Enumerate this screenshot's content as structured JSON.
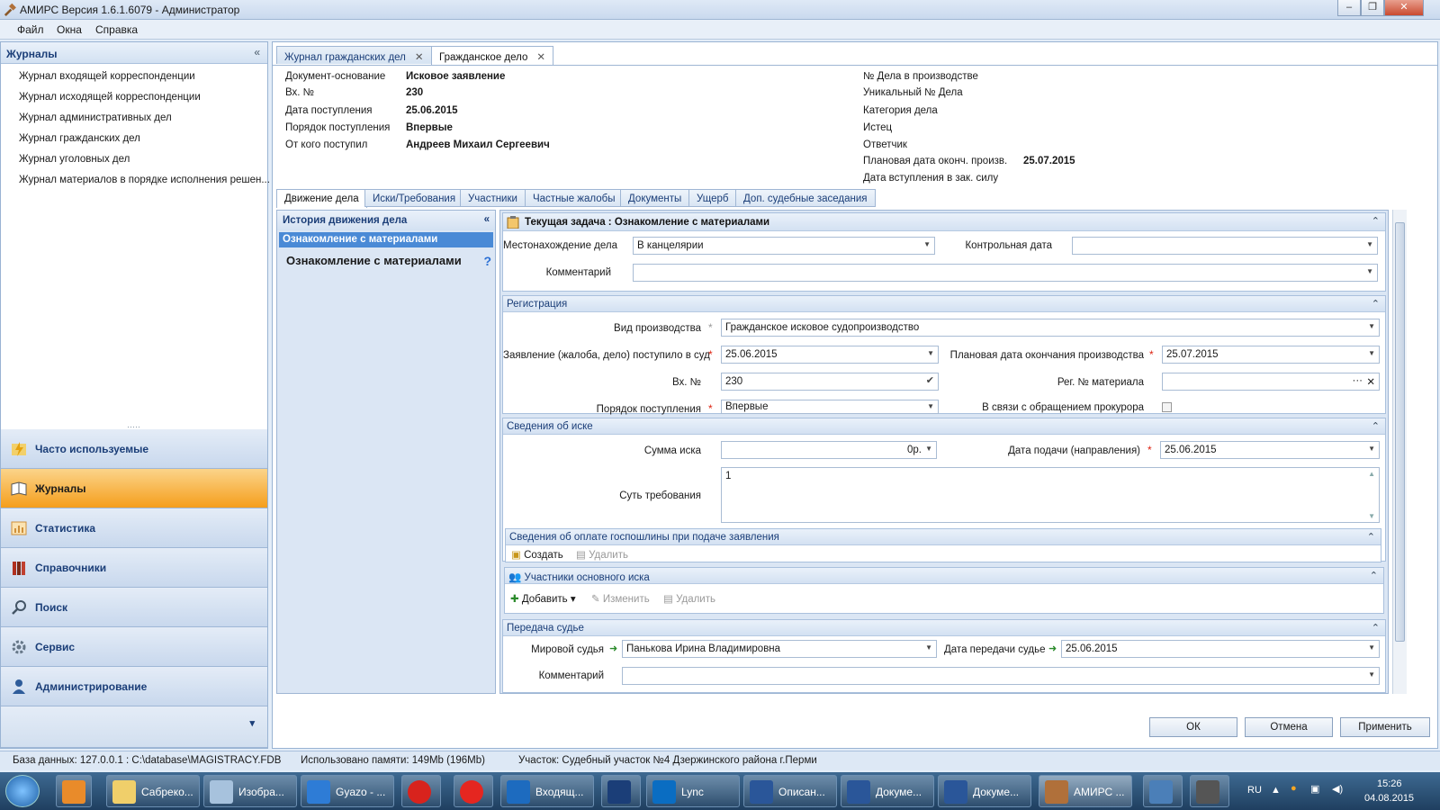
{
  "window": {
    "title": "АМИРС Версия 1.6.1.6079 - Администратор",
    "min": "‒",
    "restore": "❐",
    "close": "✕"
  },
  "menu": [
    "Файл",
    "Окна",
    "Справка"
  ],
  "left": {
    "header": "Журналы",
    "collapse": "«",
    "journals": [
      "Журнал входящей корреспонденции",
      "Журнал исходящей корреспонденции",
      "Журнал административных дел",
      "Журнал гражданских дел",
      "Журнал уголовных дел",
      "Журнал материалов в порядке исполнения решен..."
    ],
    "splitter": "·····",
    "nav": [
      "Часто используемые",
      "Журналы",
      "Статистика",
      "Справочники",
      "Поиск",
      "Сервис",
      "Администрирование"
    ],
    "nav_bottom": "▾"
  },
  "tabs": [
    {
      "label": "Журнал гражданских дел",
      "close": "✕"
    },
    {
      "label": "Гражданское дело",
      "close": "✕"
    }
  ],
  "header_left": [
    {
      "label": "Документ-основание",
      "value": "Исковое заявление"
    },
    {
      "label": "Вх. №",
      "value": "230"
    },
    {
      "label": "Дата поступления",
      "value": "25.06.2015"
    },
    {
      "label": "Порядок поступления",
      "value": "Впервые"
    },
    {
      "label": "От кого поступил",
      "value": "Андреев Михаил Сергеевич"
    }
  ],
  "header_right": [
    {
      "label": "№ Дела в производстве",
      "value": ""
    },
    {
      "label": "Уникальный № Дела",
      "value": ""
    },
    {
      "label": "Категория дела",
      "value": ""
    },
    {
      "label": "Истец",
      "value": ""
    },
    {
      "label": "Ответчик",
      "value": ""
    },
    {
      "label": "Плановая дата оконч. произв.",
      "value": "25.07.2015"
    },
    {
      "label": "Дата вступления в зак. силу",
      "value": ""
    }
  ],
  "subtabs": [
    "Движение дела",
    "Иски/Требования",
    "Участники",
    "Частные жалобы",
    "Документы",
    "Ущерб",
    "Доп. судебные заседания"
  ],
  "history": {
    "title": "История движения дела",
    "collapse": "«",
    "selected": "Ознакомление с материалами",
    "current": "Ознакомление с материалами",
    "help": "?"
  },
  "task": {
    "title_prefix": "Текущая задача : ",
    "title": "Ознакомление с материалами",
    "location_label": "Местонахождение дела",
    "location_value": "В канцелярии",
    "control_date_label": "Контрольная дата",
    "control_date_value": "",
    "comment_label": "Комментарий",
    "comment_value": ""
  },
  "registration": {
    "title": "Регистрация",
    "kind_label": "Вид производства",
    "kind_value": "Гражданское исковое судопроизводство",
    "filed_label": "Заявление (жалоба, дело) поступило в суд",
    "filed_value": "25.06.2015",
    "planned_label": "Плановая дата окончания производства",
    "planned_value": "25.07.2015",
    "inno_label": "Вх. №",
    "inno_value": "230",
    "regno_label": "Рег. № материала",
    "regno_value": "",
    "regno_more": "···",
    "regno_clear": "✕",
    "order_label": "Порядок поступления",
    "order_value": "Впервые",
    "prosecutor_label": "В связи с обращением прокурора"
  },
  "claim": {
    "title": "Сведения об иске",
    "sum_label": "Сумма иска",
    "sum_value": "0р.",
    "date_label": "Дата подачи (направления)",
    "date_value": "25.06.2015",
    "essence_label": "Суть требования",
    "essence_value": "1"
  },
  "duty": {
    "title": "Сведения об оплате госпошлины при подаче заявления",
    "create": "Создать",
    "delete": "Удалить"
  },
  "participants": {
    "title": "Участники основного иска",
    "add": "Добавить",
    "change": "Изменить",
    "delete": "Удалить"
  },
  "transfer": {
    "title": "Передача судье",
    "judge_label": "Мировой судья",
    "judge_value": "Панькова Ирина  Владимировна",
    "date_label": "Дата передачи судье",
    "date_value": "25.06.2015",
    "comment_label": "Комментарий",
    "comment_value": ""
  },
  "buttons": {
    "ok": "ОК",
    "cancel": "Отмена",
    "apply": "Применить"
  },
  "status": {
    "db": "База данных: 127.0.0.1 : C:\\database\\MAGISTRACY.FDB",
    "memory": "Использовано памяти: 149Mb (196Mb)",
    "site": "Участок: Судебный участок №4 Дзержинского района г.Перми"
  },
  "taskbar": {
    "items": [
      "Сабреко...",
      "Изобра...",
      "Gyazo - ...",
      "",
      "",
      "Входящ...",
      "",
      "Lync",
      "Описан...",
      "Докуме...",
      "Докуме...",
      "АМИРС ...",
      "",
      ""
    ],
    "lang": "RU",
    "time": "15:26",
    "date": "04.08.2015"
  },
  "colors": {
    "accent": "#1b3e78",
    "active_nav": "#f59e1c",
    "selection": "#4a8ad6",
    "required": "#dd2211"
  }
}
